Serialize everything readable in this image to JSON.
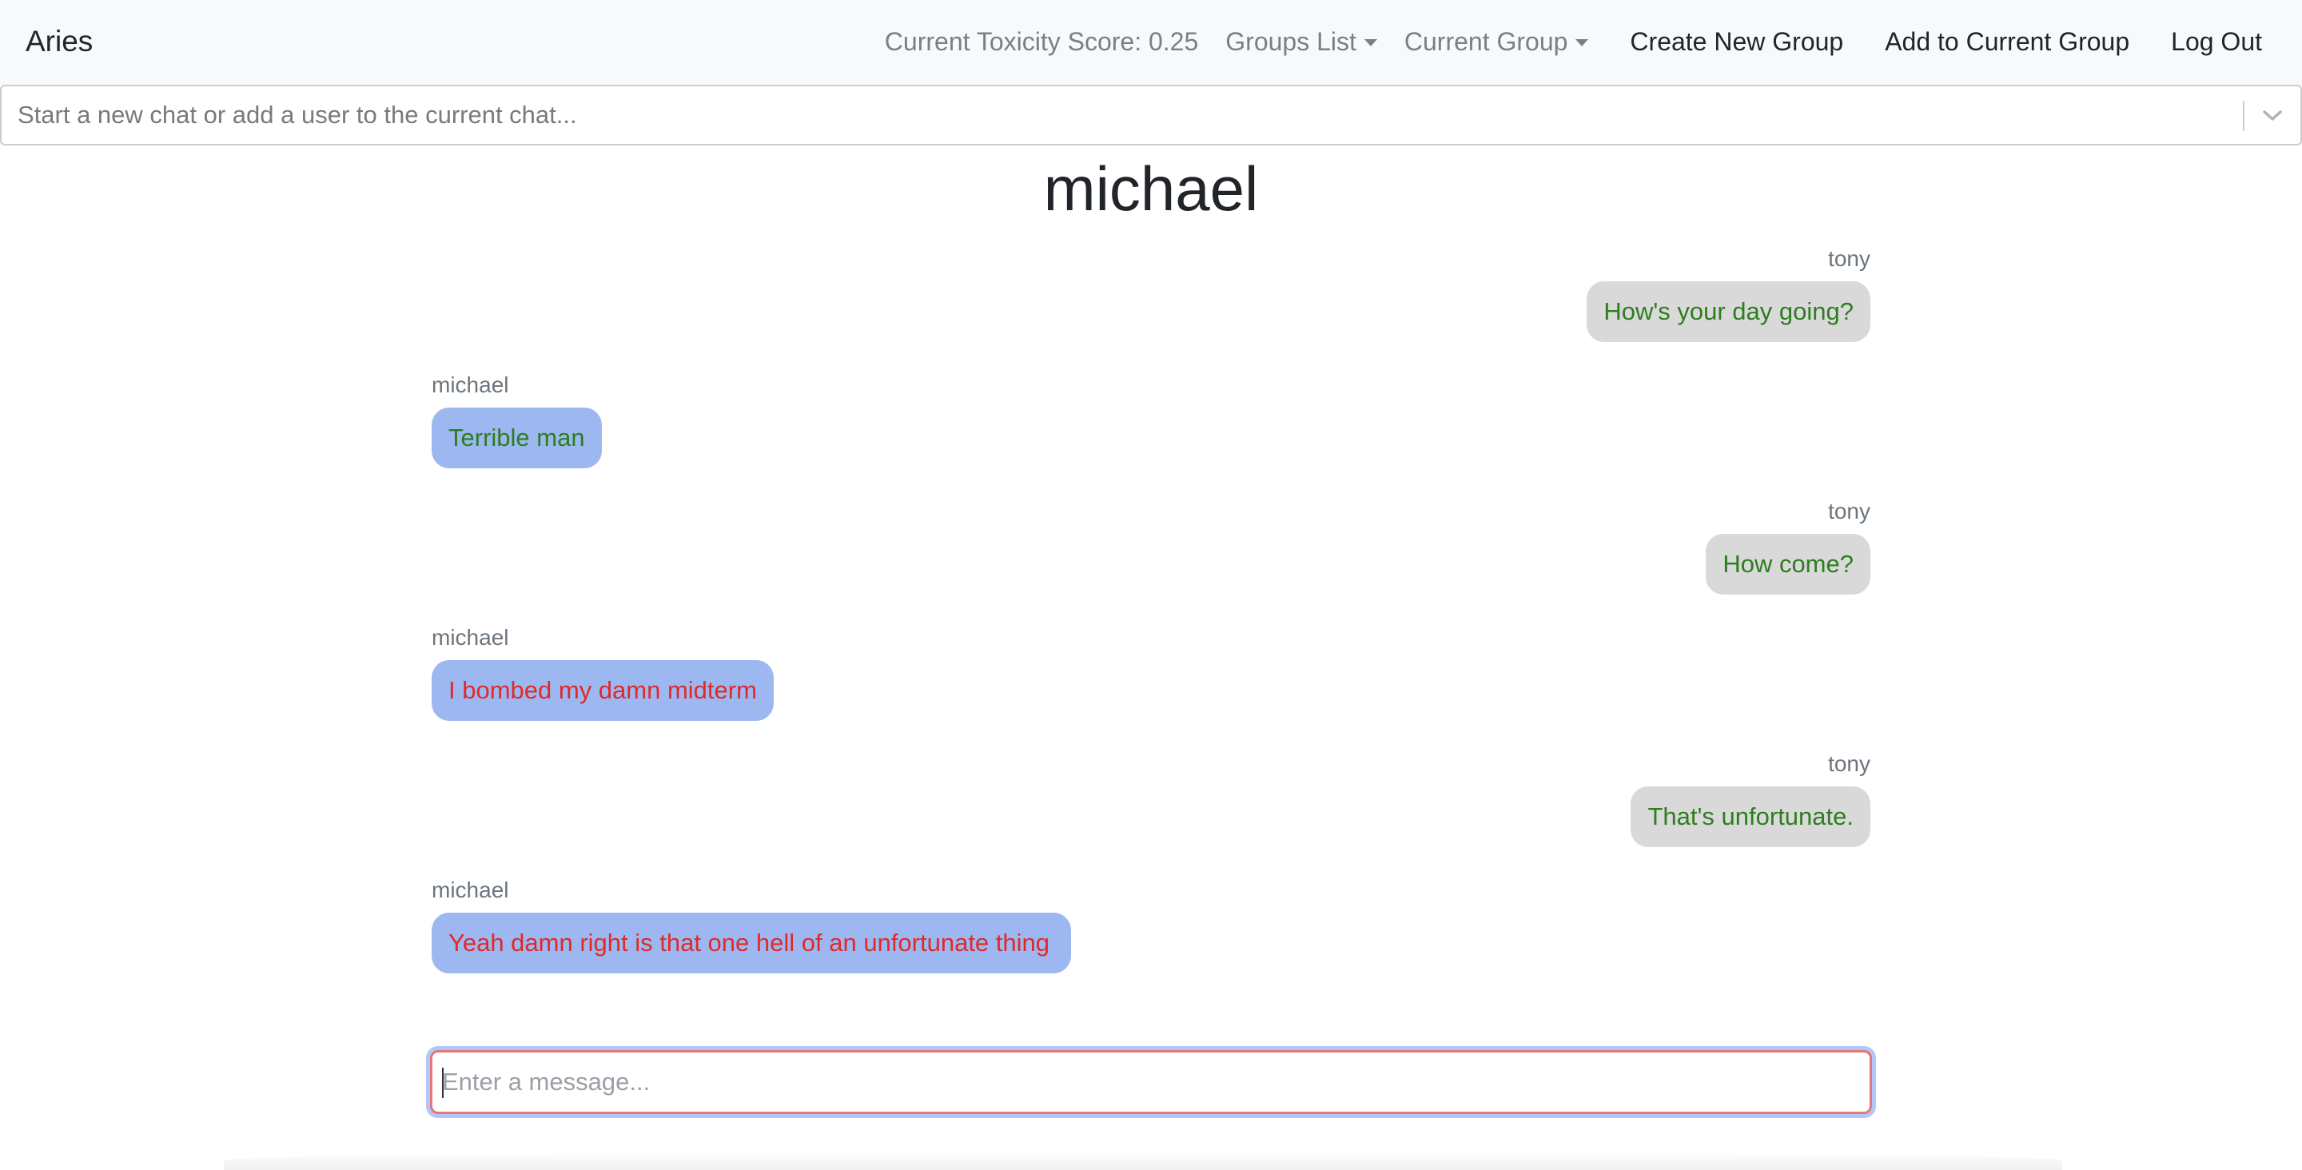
{
  "navbar": {
    "brand": "Aries",
    "toxicity_label": "Current Toxicity Score: 0.25",
    "groups_list": "Groups List",
    "current_group": "Current Group",
    "create_group": "Create New Group",
    "add_to_group": "Add to Current Group",
    "logout": "Log Out"
  },
  "search": {
    "placeholder": "Start a new chat or add a user to the current chat..."
  },
  "chat": {
    "title": "michael",
    "messages": [
      {
        "author": "tony",
        "text": "How's your day going?",
        "toxic": false
      },
      {
        "author": "michael",
        "text": "Terrible man",
        "toxic": false
      },
      {
        "author": "tony",
        "text": "How come?",
        "toxic": false
      },
      {
        "author": "michael",
        "text": "I bombed my damn midterm",
        "toxic": true
      },
      {
        "author": "tony",
        "text": "That's unfortunate.",
        "toxic": false
      },
      {
        "author": "michael",
        "text": "Yeah damn right is that one hell of an unfortunate thing",
        "toxic": true
      }
    ]
  },
  "composer": {
    "placeholder": "Enter a message..."
  },
  "colors": {
    "sent_bubble": "#d9d9d9",
    "received_bubble": "#9db8f1",
    "ok_text": "#2e7d1f",
    "toxic_text": "#e02929"
  }
}
